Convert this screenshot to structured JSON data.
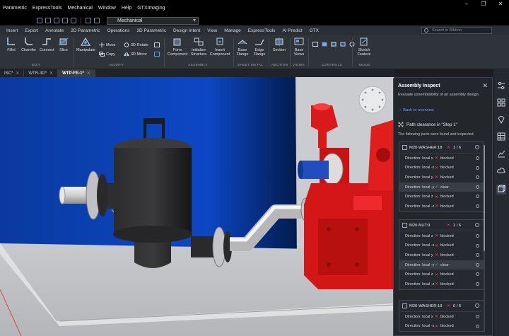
{
  "menu": [
    "Parametric",
    "ExpressTools",
    "Mechanical",
    "Window",
    "Help",
    "GTXImaging"
  ],
  "workspace": "Mechanical",
  "ribbon_tabs": [
    "Insert",
    "Export",
    "Annotate",
    "2D Parametric",
    "Operations",
    "3D Parametric",
    "Design Intent",
    "View",
    "Manage",
    "ExpressTools",
    "AI Predict",
    "GTX"
  ],
  "search_placeholder": "Search in Ribbon",
  "ribbon": {
    "edit": [
      "Fillet",
      "Chamfer",
      "Connect",
      "Slice"
    ],
    "modify_large": "Manipulate",
    "modify_small": [
      "Move",
      "3D Rotate",
      "Copy",
      "3D Mirror"
    ],
    "assembly": [
      "Form Component",
      "Initialize Structure",
      "Insert Component"
    ],
    "sheet_metal": [
      "Base Flange",
      "Edge Flange"
    ],
    "section": "Section",
    "views": "Base Views",
    "mode": "Sketch Feature",
    "groups": [
      "EDIT",
      "MODIFY",
      "ASSEMBLY",
      "SHEET METAL",
      "SECTION",
      "VIEWS",
      "CONTROLS",
      "MODE"
    ]
  },
  "doc_tabs": [
    "ISC*",
    "WTR-3D*",
    "WTP-FE-1*"
  ],
  "panel": {
    "title": "Assembly Inspect",
    "description": "Evaluate assemblability of an assembly design.",
    "back": "Back to overview",
    "path": "Path clearance in \"Step 1\"",
    "found": "The following parts were found and inspected.",
    "cards": [
      {
        "name": "M20-WASHER:18",
        "count": "1 / 6",
        "rows": [
          {
            "dir": "Direction: local x",
            "status": "blocked"
          },
          {
            "dir": "Direction: local -x",
            "status": "blocked"
          },
          {
            "dir": "Direction: local y",
            "status": "blocked"
          },
          {
            "dir": "Direction: local -y",
            "status": "clear"
          },
          {
            "dir": "Direction: local z",
            "status": "blocked"
          },
          {
            "dir": "Direction: local -z",
            "status": "blocked"
          }
        ]
      },
      {
        "name": "M20-NUT:9",
        "count": "1 / 6",
        "rows": [
          {
            "dir": "Direction: local x",
            "status": "blocked"
          },
          {
            "dir": "Direction: local -x",
            "status": "blocked"
          },
          {
            "dir": "Direction: local y",
            "status": "blocked"
          },
          {
            "dir": "Direction: local -y",
            "status": "clear"
          },
          {
            "dir": "Direction: local z",
            "status": "blocked"
          },
          {
            "dir": "Direction: local -z",
            "status": "blocked"
          }
        ]
      },
      {
        "name": "M20-WASHER:19",
        "count": "0 / 6",
        "rows": [
          {
            "dir": "Direction: local x",
            "status": "blocked"
          },
          {
            "dir": "Direction: local -x",
            "status": "blocked"
          }
        ]
      }
    ]
  },
  "colors": {
    "accent": "#5fa3ff",
    "blocked": "#e24b4b",
    "clear": "#4fc27a",
    "pump_red": "#d81a1a",
    "tank_blue": "#0a3fa8"
  }
}
